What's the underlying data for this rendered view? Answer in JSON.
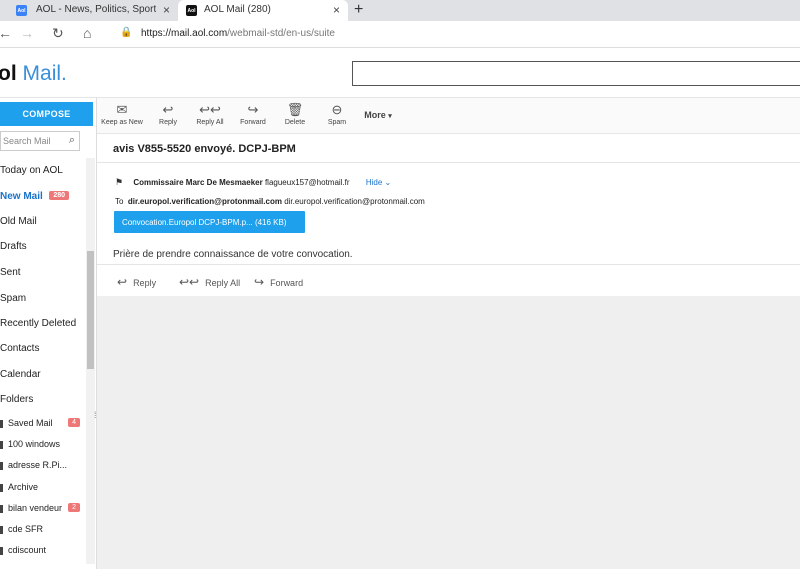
{
  "browser": {
    "tabs": [
      {
        "title": "AOL - News, Politics, Sports, Mail"
      },
      {
        "title": "AOL Mail (280)"
      }
    ],
    "new_tab": "+",
    "url_host": "https://mail.aol.com",
    "url_path": "/webmail-std/en-us/suite"
  },
  "header": {
    "logo_prefix": "ol",
    "logo_mail": "Mail.",
    "logo_dot": ""
  },
  "sidebar": {
    "compose_label": "COMPOSE",
    "search_placeholder": "Search Mail",
    "items": [
      {
        "label": "Today on AOL"
      },
      {
        "label": "New Mail",
        "badge": "280"
      },
      {
        "label": "Old Mail"
      },
      {
        "label": "Drafts"
      },
      {
        "label": "Sent"
      },
      {
        "label": "Spam"
      },
      {
        "label": "Recently Deleted"
      },
      {
        "label": "Contacts"
      },
      {
        "label": "Calendar"
      },
      {
        "label": "Folders"
      }
    ],
    "subfolders": [
      {
        "label": "Saved Mail",
        "badge": "4"
      },
      {
        "label": "100 windows"
      },
      {
        "label": "adresse R.Pi..."
      },
      {
        "label": "Archive"
      },
      {
        "label": "bilan vendeur",
        "badge": "2"
      },
      {
        "label": "cde SFR"
      },
      {
        "label": "cdiscount"
      }
    ]
  },
  "toolbar": {
    "keep_as_new": "Keep as New",
    "reply": "Reply",
    "reply_all": "Reply All",
    "forward": "Forward",
    "delete": "Delete",
    "spam": "Spam",
    "more": "More"
  },
  "message": {
    "subject": "avis V855-5520 envoyé. DCPJ-BPM",
    "from_name": "Commissaire Marc De Mesmaeker",
    "from_email": "flagueux157@hotmail.fr",
    "hide_label": "Hide",
    "to_label": "To",
    "to_bold": "dir.europol.verification@protonmail.com",
    "to_plain": "dir.europol.verification@protonmail.com",
    "attachment": "Convocation.Europol DCPJ-BPM.p... (416 KB)",
    "body": "Prière de prendre connaissance de votre convocation.",
    "actions": {
      "reply": "Reply",
      "reply_all": "Reply All",
      "forward": "Forward"
    }
  }
}
